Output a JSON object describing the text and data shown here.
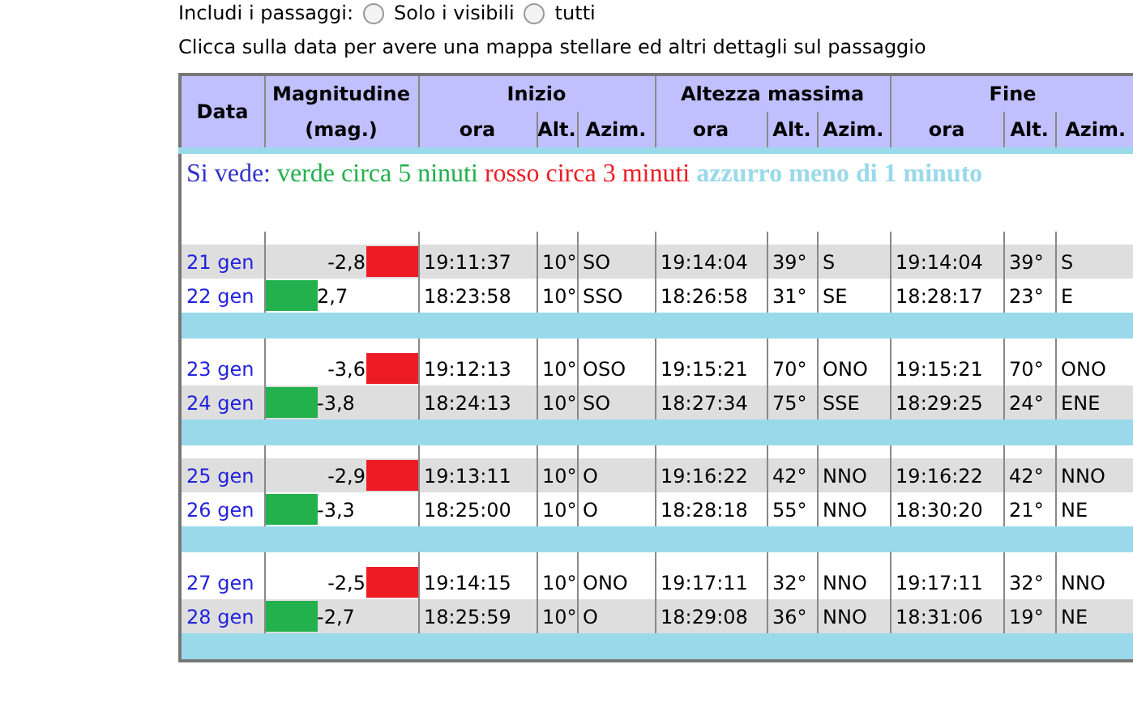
{
  "filter": {
    "label": "Includi i passaggi:",
    "options": [
      {
        "label": "Solo i visibili",
        "selected": false
      },
      {
        "label": "tutti",
        "selected": false
      }
    ]
  },
  "hint": "Clicca sulla data per avere una mappa stellare ed altri dettagli sul passaggio",
  "table": {
    "headers": {
      "data": "Data",
      "magnitude": "Magnitudine",
      "magnitude_unit": "(mag.)",
      "groups": [
        {
          "label": "Inizio",
          "subcolumns": [
            "ora",
            "Alt.",
            "Azim."
          ]
        },
        {
          "label": "Altezza massima",
          "subcolumns": [
            "ora",
            "Alt.",
            "Azim."
          ]
        },
        {
          "label": "Fine",
          "subcolumns": [
            "ora",
            "Alt.",
            "Azim."
          ]
        }
      ]
    },
    "legend": [
      {
        "text": "Si vede:",
        "color": "#3333cc"
      },
      {
        "text": "verde circa 5 ninuti",
        "color": "#22b14c"
      },
      {
        "text": "rosso circa 3 minuti",
        "color": "#ed1c24"
      },
      {
        "text": "azzurro meno di 1 minuto",
        "color": "#99d9ea"
      }
    ],
    "groups": [
      {
        "rows": [
          {
            "date": "21 gen",
            "mag": "-2,8",
            "kind": "bar-right",
            "color": "#ed1c24",
            "shaded": true,
            "cells": [
              "19:11:37",
              "10°",
              "SO",
              "19:14:04",
              "39°",
              "S",
              "19:14:04",
              "39°",
              "S"
            ]
          },
          {
            "date": "22 gen",
            "mag": "2,7",
            "kind": "bar-left",
            "color": "#22b14c",
            "shaded": false,
            "cells": [
              "18:23:58",
              "10°",
              "SSO",
              "18:26:58",
              "31°",
              "SE",
              "18:28:17",
              "23°",
              "E"
            ]
          }
        ]
      },
      {
        "rows": [
          {
            "date": "23 gen",
            "mag": "-3,6",
            "kind": "bar-right",
            "color": "#ed1c24",
            "shaded": false,
            "cells": [
              "19:12:13",
              "10°",
              "OSO",
              "19:15:21",
              "70°",
              "ONO",
              "19:15:21",
              "70°",
              "ONO"
            ]
          },
          {
            "date": "24 gen",
            "mag": "-3,8",
            "kind": "bar-left",
            "color": "#22b14c",
            "shaded": true,
            "cells": [
              "18:24:13",
              "10°",
              "SO",
              "18:27:34",
              "75°",
              "SSE",
              "18:29:25",
              "24°",
              "ENE"
            ]
          }
        ]
      },
      {
        "rows": [
          {
            "date": "25 gen",
            "mag": "-2,9",
            "kind": "bar-right",
            "color": "#ed1c24",
            "shaded": true,
            "cells": [
              "19:13:11",
              "10°",
              "O",
              "19:16:22",
              "42°",
              "NNO",
              "19:16:22",
              "42°",
              "NNO"
            ]
          },
          {
            "date": "26 gen",
            "mag": "-3,3",
            "kind": "bar-left",
            "color": "#22b14c",
            "shaded": false,
            "cells": [
              "18:25:00",
              "10°",
              "O",
              "18:28:18",
              "55°",
              "NNO",
              "18:30:20",
              "21°",
              "NE"
            ]
          }
        ]
      },
      {
        "rows": [
          {
            "date": "27 gen",
            "mag": "-2,5",
            "kind": "bar-right",
            "color": "#ed1c24",
            "shaded": false,
            "cells": [
              "19:14:15",
              "10°",
              "ONO",
              "19:17:11",
              "32°",
              "NNO",
              "19:17:11",
              "32°",
              "NNO"
            ]
          },
          {
            "date": "28 gen",
            "mag": "-2,7",
            "kind": "bar-left",
            "color": "#22b14c",
            "shaded": true,
            "cells": [
              "18:25:59",
              "10°",
              "O",
              "18:29:08",
              "36°",
              "NNO",
              "18:31:06",
              "19°",
              "NE"
            ]
          }
        ]
      }
    ]
  }
}
